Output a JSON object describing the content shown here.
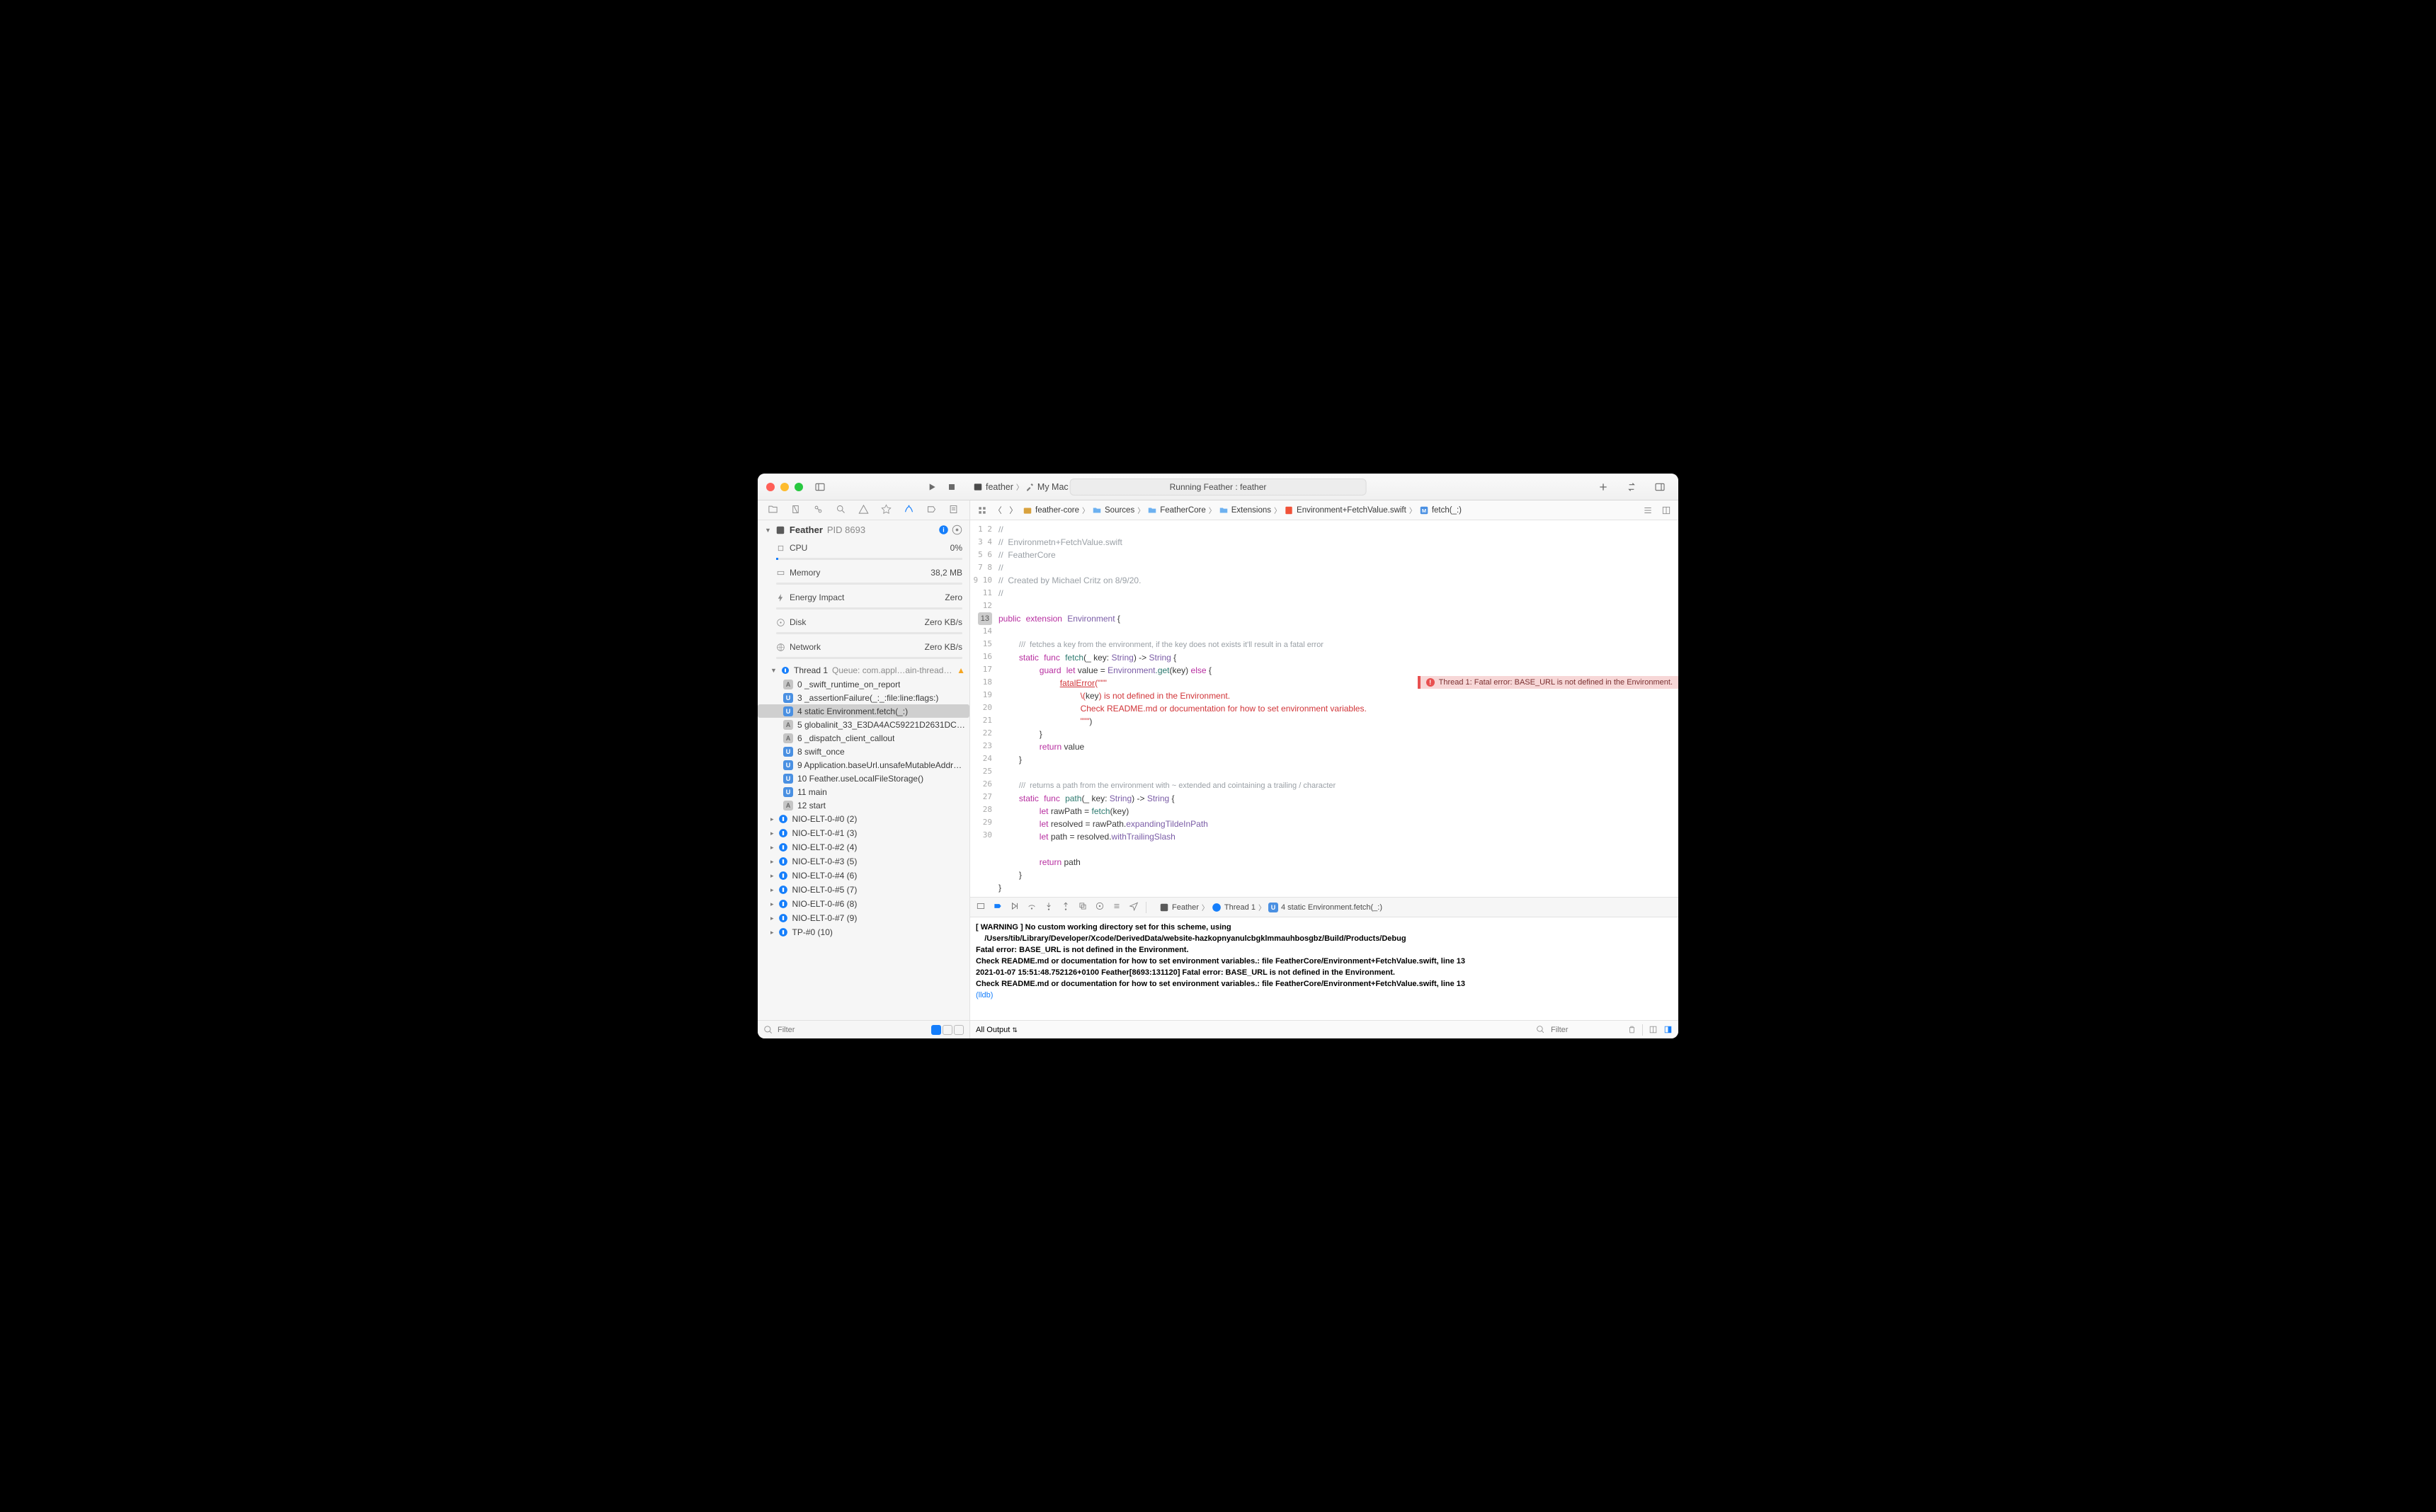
{
  "titlebar": {
    "scheme_target": "feather",
    "destination": "My Mac",
    "status": "Running Feather : feather"
  },
  "navigator": {
    "process_name": "Feather",
    "pid_label": "PID 8693",
    "metrics": {
      "cpu": {
        "label": "CPU",
        "value": "0%"
      },
      "memory": {
        "label": "Memory",
        "value": "38,2 MB"
      },
      "energy": {
        "label": "Energy Impact",
        "value": "Zero"
      },
      "disk": {
        "label": "Disk",
        "value": "Zero KB/s"
      },
      "network": {
        "label": "Network",
        "value": "Zero KB/s"
      }
    },
    "thread1_label": "Thread 1",
    "thread1_queue": "Queue: com.appl…ain-thread (serial)",
    "frames": [
      "0 _swift_runtime_on_report",
      "3 _assertionFailure(_:_:file:line:flags:)",
      "4 static Environment.fetch(_:)",
      "5 globalinit_33_E3DA4AC59221D2631DC46…",
      "6 _dispatch_client_callout",
      "8 swift_once",
      "9 Application.baseUrl.unsafeMutableAddres…",
      "10 Feather.useLocalFileStorage()",
      "11 main",
      "12 start"
    ],
    "other_threads": [
      "NIO-ELT-0-#0 (2)",
      "NIO-ELT-0-#1 (3)",
      "NIO-ELT-0-#2 (4)",
      "NIO-ELT-0-#3 (5)",
      "NIO-ELT-0-#4 (6)",
      "NIO-ELT-0-#5 (7)",
      "NIO-ELT-0-#6 (8)",
      "NIO-ELT-0-#7 (9)",
      "TP-#0 (10)"
    ],
    "filter_placeholder": "Filter"
  },
  "jumpbar": {
    "crumbs": [
      "feather-core",
      "Sources",
      "FeatherCore",
      "Extensions",
      "Environment+FetchValue.swift",
      "fetch(_:)"
    ]
  },
  "code": {
    "l1": "//",
    "l2a": "//  ",
    "l2b": "Environmetn+FetchValue.swift",
    "l3a": "//  ",
    "l3b": "FeatherCore",
    "l4": "//",
    "l5a": "//  ",
    "l5b": "Created by Michael Critz on 8/9/20.",
    "l6": "//",
    "l8_public": "public",
    "l8_ext": "extension",
    "l8_env": "Environment",
    "l8_brace": " {",
    "l10_doc": "///  fetches a key from the environment, if the key does not exists it'll result in a fatal error",
    "l11_static": "static",
    "l11_func": "func",
    "l11_name": "fetch",
    "l11_sig1": "(_ key: ",
    "l11_str": "String",
    "l11_sig2": ") -> ",
    "l11_ret": "String",
    "l11_brace": " {",
    "l12_guard": "guard",
    "l12_let": "let",
    "l12_val": " value = ",
    "l12_env": "Environment",
    "l12_get": ".get",
    "l12_key": "(key) ",
    "l12_else": "else",
    "l12_brace": " {",
    "l13_fatal": "fatalError",
    "l13_q": "(\"\"\"",
    "l14a": "\\(",
    "l14b": "key",
    "l14c": ") ",
    "l14d": "is not defined in the Environment.",
    "l15": "Check README.md or documentation for how to set environment variables.",
    "l16": "\"\"\"",
    "l16b": ")",
    "l17": "}",
    "l18_ret": "return",
    "l18_val": " value",
    "l19": "}",
    "l21_doc": "///  returns a path from the environment with ~ extended and cointaining a trailing / character",
    "l22_static": "static",
    "l22_func": "func",
    "l22_name": "path",
    "l22_sig1": "(_ key: ",
    "l22_str": "String",
    "l22_sig2": ") -> ",
    "l22_ret": "String",
    "l22_brace": " {",
    "l23_let": "let",
    "l23_raw": " rawPath = ",
    "l23_fetch": "fetch",
    "l23_key": "(key)",
    "l24_let": "let",
    "l24_res": " resolved = rawPath.",
    "l24_prop": "expandingTildeInPath",
    "l25_let": "let",
    "l25_path": " path = resolved.",
    "l25_prop": "withTrailingSlash",
    "l27_ret": "return",
    "l27_val": " path",
    "l28": "}",
    "l29": "}"
  },
  "error_banner": "Thread 1: Fatal error: BASE_URL is not defined in the Environment.",
  "debug": {
    "crumb_process": "Feather",
    "crumb_thread": "Thread 1",
    "crumb_frame": "4 static Environment.fetch(_:)",
    "console_text": "[ WARNING ] No custom working directory set for this scheme, using\n    /Users/tib/Library/Developer/Xcode/DerivedData/website-hazkopnyanulcbgklmmauhbosgbz/Build/Products/Debug\nFatal error: BASE_URL is not defined in the Environment.\nCheck README.md or documentation for how to set environment variables.: file FeatherCore/Environment+FetchValue.swift, line 13\n2021-01-07 15:51:48.752126+0100 Feather[8693:131120] Fatal error: BASE_URL is not defined in the Environment.\nCheck README.md or documentation for how to set environment variables.: file FeatherCore/Environment+FetchValue.swift, line 13",
    "lldb_prompt": "(lldb)",
    "output_label": "All Output",
    "filter_placeholder": "Filter"
  }
}
